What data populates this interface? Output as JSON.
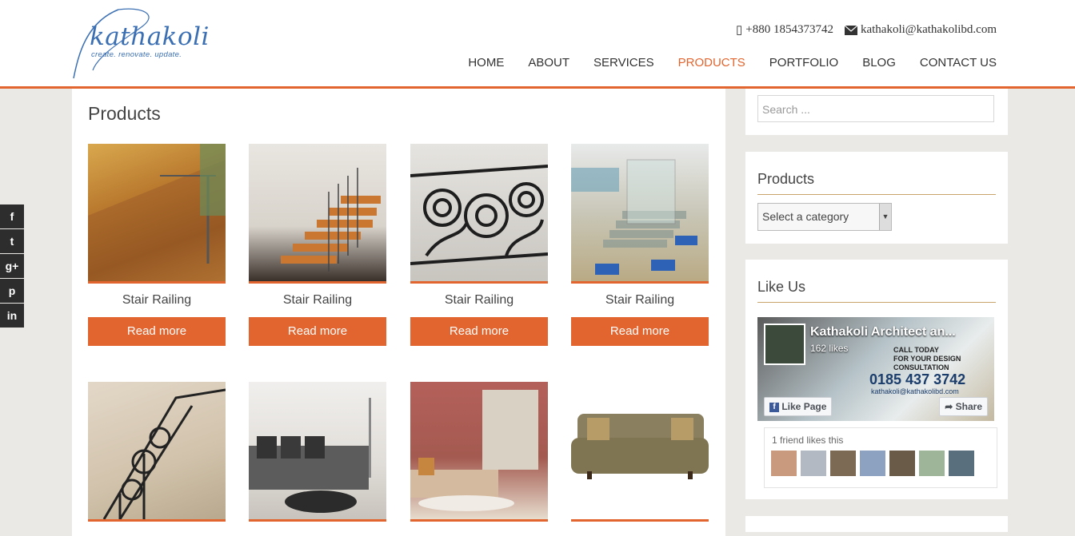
{
  "brand": {
    "logo_text": "kathakoli",
    "tagline": "create. renovate. update.",
    "primary_color": "#e2652f",
    "logo_color": "#3b6fb3"
  },
  "contact": {
    "phone_icon": "mobile-icon",
    "phone": "+880 1854373742",
    "email_icon": "envelope-icon",
    "email": "kathakoli@kathakolibd.com"
  },
  "nav": {
    "home": "HOME",
    "about": "ABOUT",
    "services": "SERVICES",
    "products": "PRODUCTS",
    "portfolio": "PORTFOLIO",
    "blog": "BLOG",
    "contact": "CONTACT US"
  },
  "main": {
    "title": "Products",
    "products": [
      {
        "name": "Stair Railing",
        "button": "Read more"
      },
      {
        "name": "Stair Railing",
        "button": "Read more"
      },
      {
        "name": "Stair Railing",
        "button": "Read more"
      },
      {
        "name": "Stair Railing",
        "button": "Read more"
      }
    ]
  },
  "sidebar": {
    "search_placeholder": "Search ...",
    "products_title": "Products",
    "category_select": "Select a category",
    "like_title": "Like Us",
    "fb": {
      "page_name": "Kathakoli Architect an...",
      "likes": "162 likes",
      "like_button": "Like Page",
      "share_button": "Share",
      "friends_text": "1 friend likes this",
      "cover_text_1": "CALL TODAY",
      "cover_text_2": "FOR YOUR DESIGN",
      "cover_text_3": "CONSULTATION",
      "cover_phone": "0185 437 3742",
      "cover_email": "kathakoli@kathakolibd.com"
    }
  },
  "social": {
    "facebook": "f",
    "twitter": "t",
    "googleplus": "g+",
    "pinterest": "p",
    "linkedin": "in"
  }
}
